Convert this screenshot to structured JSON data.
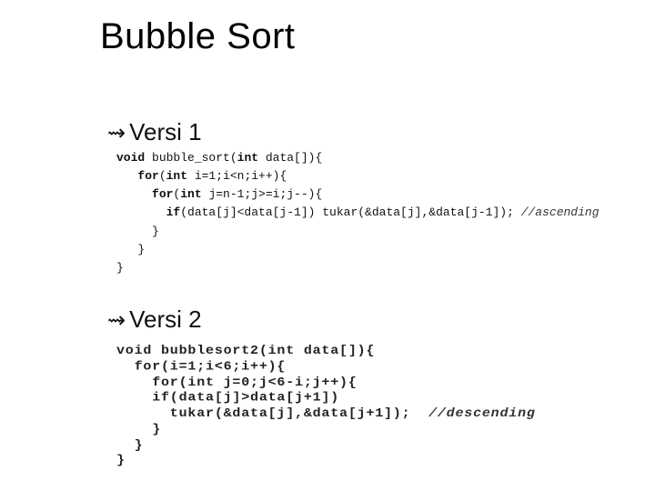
{
  "title": "Bubble Sort",
  "bullet_glyph": "⇝",
  "sections": {
    "v1": {
      "label": "Versi 1"
    },
    "v2": {
      "label": "Versi 2"
    }
  },
  "code_v1": {
    "l1a": "void",
    "l1b": " bubble_sort(",
    "l1c": "int",
    "l1d": " data[]){",
    "l2a": "for",
    "l2b": "(",
    "l2c": "int",
    "l2d": " i=1;i<n;i++){",
    "l3a": "for",
    "l3b": "(",
    "l3c": "int",
    "l3d": " j=n-1;j>=i;j--){",
    "l4a": "if",
    "l4b": "(data[j]<data[j-1]) tukar(&data[j],&data[j-1]); ",
    "l4c": "//ascending",
    "l5": "}",
    "l6": "}",
    "l7": "}"
  },
  "code_v2": {
    "l1": "void bubblesort2(int data[]){",
    "l2": "  for(i=1;i<6;i++){",
    "l3": "    for(int j=0;j<6-i;j++){",
    "l4": "    if(data[j]>data[j+1])",
    "l5": "      tukar(&data[j],&data[j+1]);  ",
    "l5c": "//descending",
    "l6": "    }",
    "l7": "  }",
    "l8": "}"
  }
}
